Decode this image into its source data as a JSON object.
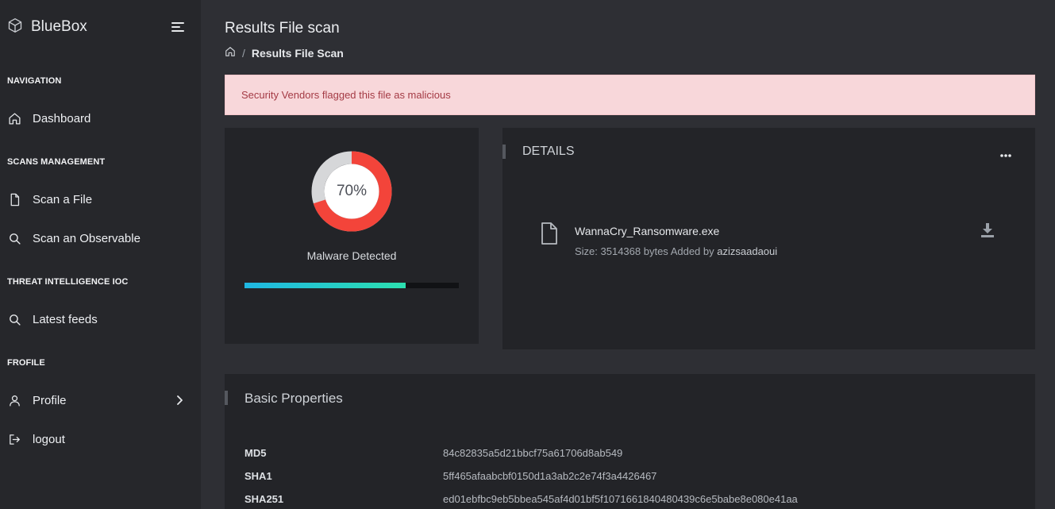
{
  "app": {
    "name": "BlueBox"
  },
  "sidebar": {
    "sections": {
      "navigation": "NAVIGATION",
      "scans": "SCANS MANAGEMENT",
      "threat": "THREAT INTELLIGENCE IOC",
      "profile": "FROFILE"
    },
    "items": {
      "dashboard": "Dashboard",
      "scan_file": "Scan a File",
      "scan_observable": "Scan an Observable",
      "latest_feeds": "Latest feeds",
      "profile": "Profile",
      "logout": "logout"
    }
  },
  "header": {
    "title": "Results File scan",
    "breadcrumb_current": "Results File Scan"
  },
  "alert": {
    "text": "Security Vendors flagged this file as malicious"
  },
  "detection": {
    "percent_label": "70%",
    "percent": 70,
    "label": "Malware Detected",
    "progress_fraction": 0.75
  },
  "details": {
    "title": "DETAILS",
    "file_name": "WannaCry_Ransomware.exe",
    "size_text": "Size: 3514368 bytes Added by",
    "added_by": "azizsaadaoui"
  },
  "basic_properties": {
    "title": "Basic Properties",
    "rows": [
      {
        "key": "MD5",
        "value": "84c82835a5d21bbcf75a61706d8ab549"
      },
      {
        "key": "SHA1",
        "value": "5ff465afaabcbf0150d1a3ab2c2e74f3a4426467"
      },
      {
        "key": "SHA251",
        "value": "ed01ebfbc9eb5bbea545af4d01bf5f1071661840480439c6e5babe8e080e41aa"
      }
    ]
  },
  "colors": {
    "gauge_red": "#f3443a",
    "gauge_gray": "#d6d7d9",
    "alert_bg": "#f8d7da",
    "alert_text": "#a43b45",
    "progress_start": "#1fb7e3",
    "progress_end": "#2ce0b0"
  }
}
